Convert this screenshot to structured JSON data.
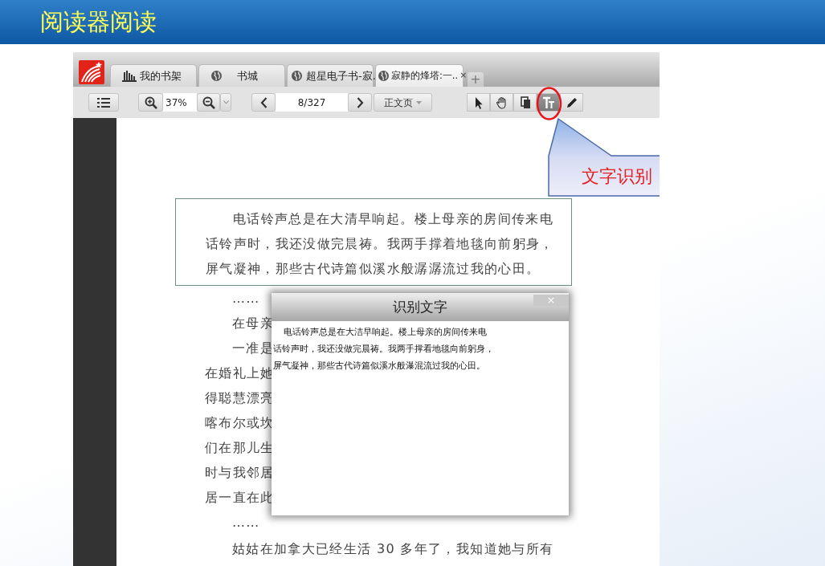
{
  "slide": {
    "title": "阅读器阅读"
  },
  "app": {
    "tabs": [
      {
        "label": "我的书架",
        "kind": "shelf",
        "selected": false
      },
      {
        "label": "书城",
        "kind": "globe",
        "selected": false
      },
      {
        "label": "超星电子书-寂..",
        "kind": "globe",
        "selected": false
      },
      {
        "label": "寂静的烽塔:一..",
        "kind": "globe",
        "selected": true,
        "close": "×"
      }
    ],
    "new_tab": "+",
    "toolbar": {
      "zoom": "37%",
      "page": "8/327",
      "view_mode": "正文页",
      "tools": [
        {
          "kind": "pointer",
          "selected": false
        },
        {
          "kind": "hand",
          "selected": false
        },
        {
          "kind": "copy",
          "selected": false
        },
        {
          "kind": "text",
          "selected": true
        },
        {
          "kind": "pen",
          "selected": false
        }
      ]
    },
    "page": {
      "selection": [
        {
          "lines": [
            "电话铃声总是在大清早响起。楼上母亲的房间传来电",
            "话铃声时，我还没做完晨祷。我两手撑着地毯向前躬身，",
            "屏气凝神，那些古代诗篇似溪水般潺潺流过我的心田。"
          ]
        }
      ],
      "paragraphs": [
        {
          "lines": [
            "……"
          ]
        },
        {
          "lines": [
            "在母亲"
          ]
        },
        {
          "lines": [
            "一准是",
            "在婚礼上她",
            "得聪慧漂亮",
            "喀布尔或坎",
            "们在那儿生",
            "时与我邻居",
            "居一直在此"
          ]
        },
        {
          "lines": [
            "……"
          ]
        },
        {
          "lines": [
            "姑姑在加拿大已经生活 30 多年了，我知道她与所有"
          ]
        }
      ]
    },
    "dialog": {
      "title": "识别文字",
      "close": "×",
      "paragraphs": [
        {
          "lines": [
            "电话铃声总是在大洁早响起。楼上母亲的房间传来电",
            "话铃声时，我还没做完晨祷。我两手撑看地毯向前躬身，",
            "屏气凝神，那些古代诗篇似溪水般瀑混流过我的心田。"
          ]
        }
      ]
    }
  },
  "callout": {
    "label": "文字识别"
  }
}
